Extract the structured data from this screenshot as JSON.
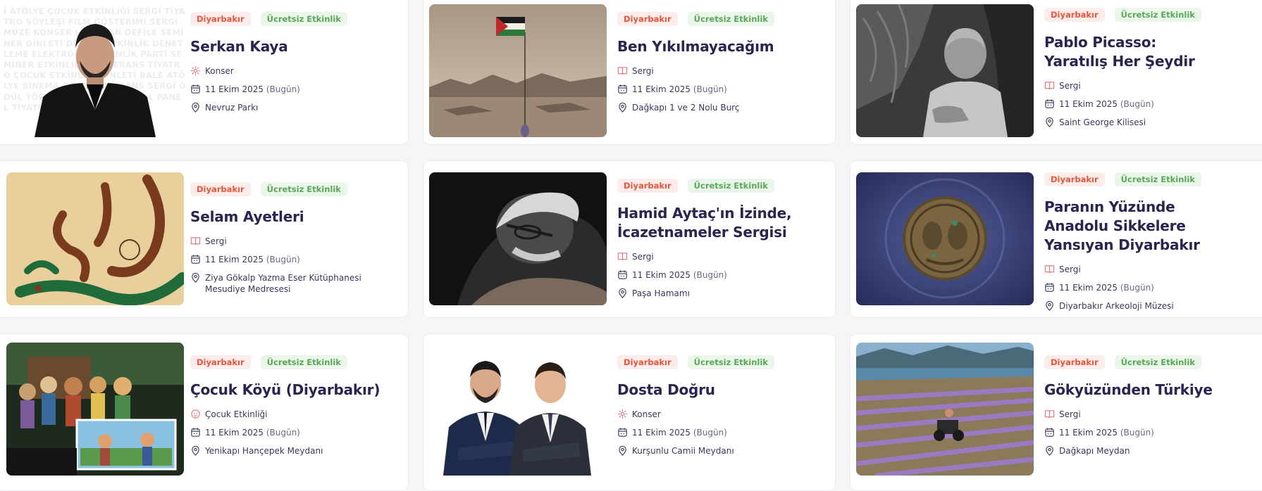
{
  "events": [
    {
      "city": "Diyarbakır",
      "free": "Ücretsiz Etkinlik",
      "title": "Serkan Kaya",
      "category": "Konser",
      "category_icon": "music-icon",
      "date": "11 Ekim 2025",
      "today": "(Bugün)",
      "venue": "Nevruz Parkı",
      "image": "portrait-man-black-suit",
      "bg_text": "İ ATÖLYE ÇOCUK ETKİNLİĞİ SERGİ TİYATRO SÖYLEŞİ FİLM GÖSTERİMİ SERGİ MÜZE KONSER LANSMAN DEFİLE SEMİNER DİNLETİ DESTEK ETKİNLİK DENETLEME ELEKTRONİK ETKİNLİK PARTİ SEMİNER ETKİNLİĞİ KONFERANS TİYATRO ÇOCUK ETKİNLİĞİ DİNLETİ BALE ATÖLYE SİNEMA GÖSTERİMİ DANS SERGİ ÖDÜL TÖRENİ SEMİNER FESTİVAL PANEL TİYATRO DANS"
    },
    {
      "city": "Diyarbakır",
      "free": "Ücretsiz Etkinlik",
      "title": "Ben Yıkılmayacağım",
      "category": "Sergi",
      "category_icon": "book-icon",
      "date": "11 Ekim 2025",
      "today": "(Bugün)",
      "venue": "Dağkapı 1 ve 2 Nolu Burç",
      "image": "painting-flag-mountains"
    },
    {
      "city": "Diyarbakır",
      "free": "Ücretsiz Etkinlik",
      "title": "Pablo Picasso: Yaratılış Her Şeydir",
      "category": "Sergi",
      "category_icon": "book-icon",
      "date": "11 Ekim 2025",
      "today": "(Bugün)",
      "venue": "Saint George Kilisesi",
      "image": "bw-portrait-old-man"
    },
    {
      "city": "Diyarbakır",
      "free": "Ücretsiz Etkinlik",
      "title": "Selam Ayetleri",
      "category": "Sergi",
      "category_icon": "book-icon",
      "date": "11 Ekim 2025",
      "today": "(Bugün)",
      "venue": "Ziya Gökalp Yazma Eser Kütüphanesi Mesudiye Medresesi",
      "image": "arabic-calligraphy"
    },
    {
      "city": "Diyarbakır",
      "free": "Ücretsiz Etkinlik",
      "title": "Hamid Aytaç'ın İzinde, İcazetnameler Sergisi",
      "category": "Sergi",
      "category_icon": "book-icon",
      "date": "11 Ekim 2025",
      "today": "(Bugün)",
      "venue": "Paşa Hamamı",
      "image": "bw-man-glasses"
    },
    {
      "city": "Diyarbakır",
      "free": "Ücretsiz Etkinlik",
      "title": "Paranın Yüzünde Anadolu Sikkelere Yansıyan Diyarbakır",
      "category": "Sergi",
      "category_icon": "book-icon",
      "date": "11 Ekim 2025",
      "today": "(Bugün)",
      "venue": "Diyarbakır Arkeoloji Müzesi",
      "image": "ancient-coin"
    },
    {
      "city": "Diyarbakır",
      "free": "Ücretsiz Etkinlik",
      "title": "Çocuk Köyü (Diyarbakır)",
      "category": "Çocuk Etkinliği",
      "category_icon": "kids-icon",
      "date": "11 Ekim 2025",
      "today": "(Bugün)",
      "venue": "Yenikapı Hançepek Meydanı",
      "image": "kids-characters"
    },
    {
      "city": "Diyarbakır",
      "free": "Ücretsiz Etkinlik",
      "title": "Dosta Doğru",
      "category": "Konser",
      "category_icon": "music-icon",
      "date": "11 Ekim 2025",
      "today": "(Bugün)",
      "venue": "Kurşunlu Camii Meydanı",
      "image": "two-men-suits"
    },
    {
      "city": "Diyarbakır",
      "free": "Ücretsiz Etkinlik",
      "title": "Gökyüzünden Türkiye",
      "category": "Sergi",
      "category_icon": "book-icon",
      "date": "11 Ekim 2025",
      "today": "(Bugün)",
      "venue": "Dağkapı Meydan",
      "image": "lavender-field"
    }
  ],
  "colors": {
    "title": "#2a2451",
    "city_tag_bg": "#fdecea",
    "city_tag_text": "#e2573d",
    "free_tag_bg": "#eaf6ea",
    "free_tag_text": "#5aa65a",
    "icon_pink": "#e8727a"
  }
}
